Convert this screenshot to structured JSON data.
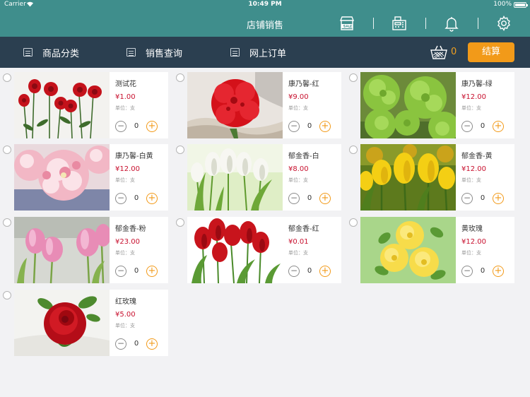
{
  "status": {
    "carrier": "Carrier",
    "time": "10:49 PM",
    "battery": "100%"
  },
  "header": {
    "title": "店铺销售"
  },
  "nav": {
    "items": [
      {
        "label": "商品分类"
      },
      {
        "label": "销售查询"
      },
      {
        "label": "网上订单"
      }
    ],
    "cart_count": "0",
    "checkout_label": "结算"
  },
  "products": [
    {
      "name": "测试花",
      "price": "¥1.00",
      "unit": "单位：支",
      "qty": "0",
      "image": "red-roses-row"
    },
    {
      "name": "康乃馨-红",
      "price": "¥9.00",
      "unit": "单位：支",
      "qty": "0",
      "image": "red-carnation"
    },
    {
      "name": "康乃馨-绿",
      "price": "¥12.00",
      "unit": "单位：支",
      "qty": "0",
      "image": "green-carnation"
    },
    {
      "name": "康乃馨-白黄",
      "price": "¥12.00",
      "unit": "单位：支",
      "qty": "0",
      "image": "pink-white-carnation"
    },
    {
      "name": "郁金香-白",
      "price": "¥8.00",
      "unit": "单位：支",
      "qty": "0",
      "image": "white-tulips"
    },
    {
      "name": "郁金香-黄",
      "price": "¥12.00",
      "unit": "单位：支",
      "qty": "0",
      "image": "yellow-tulips"
    },
    {
      "name": "郁金香-粉",
      "price": "¥23.00",
      "unit": "单位：支",
      "qty": "0",
      "image": "pink-tulips"
    },
    {
      "name": "郁金香-红",
      "price": "¥0.01",
      "unit": "单位：支",
      "qty": "0",
      "image": "red-tulips"
    },
    {
      "name": "黄玫瑰",
      "price": "¥12.00",
      "unit": "单位：支",
      "qty": "0",
      "image": "yellow-roses"
    },
    {
      "name": "红玫瑰",
      "price": "¥5.00",
      "unit": "单位：支",
      "qty": "0",
      "image": "red-rose-single"
    }
  ],
  "colors": {
    "header": "#3f8e8c",
    "nav": "#2b3f50",
    "accent": "#f29a19",
    "price": "#c8102e"
  }
}
